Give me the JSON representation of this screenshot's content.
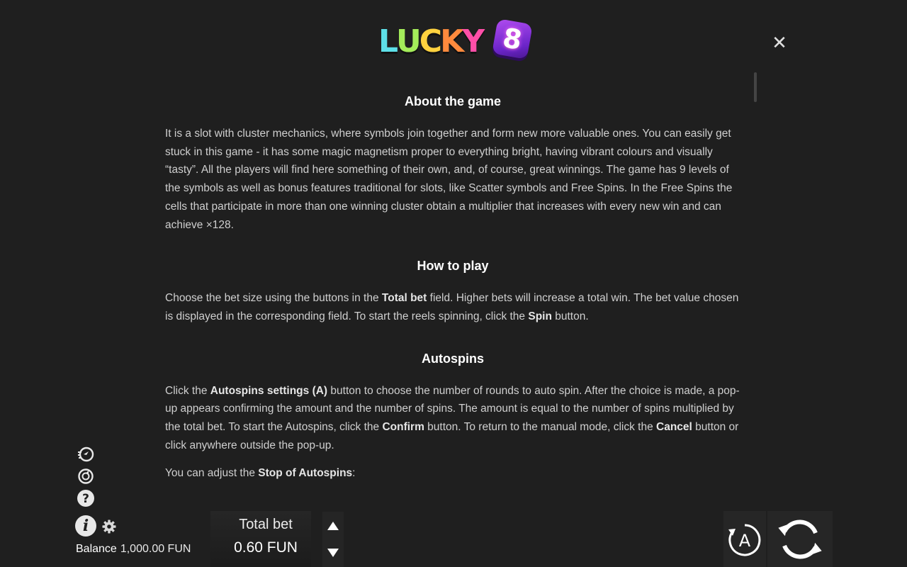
{
  "logo": {
    "letters": [
      "L",
      "U",
      "C",
      "K",
      "Y"
    ],
    "letter_colors": [
      "#5ee0e8",
      "#a4ec5a",
      "#ffd23f",
      "#ff8a3d",
      "#ff4fa8"
    ],
    "number": "8"
  },
  "close": {
    "icon": "close-icon",
    "glyph": "✕"
  },
  "rules": {
    "about": {
      "title": "About the game",
      "text": "It is a slot with cluster mechanics, where symbols join together and form new more valuable ones. You can easily get stuck in this game - it has some magic magnetism proper to everything bright, having vibrant colours and visually “tasty”. All the players will find here something of their own, and, of course, great winnings. The game has 9 levels of the symbols as well as bonus features traditional for slots, like Scatter symbols and Free Spins. In the Free Spins the cells that participate in more than one winning cluster obtain a multiplier that increases with every new win and can achieve ×128."
    },
    "how_to_play": {
      "title": "How to play",
      "t1": "Choose the bet size using the buttons in the ",
      "b1": "Total bet",
      "t2": " field. Higher bets will increase a total win. The bet value chosen is displayed in the corresponding field. To start the reels spinning, click the ",
      "b2": "Spin",
      "t3": " button."
    },
    "autospins": {
      "title": "Autospins",
      "t1": "Click the ",
      "b1": "Autospins settings (A)",
      "t2": " button to choose the number of rounds to auto spin. After the choice is made, a pop-up appears confirming the amount and the number of spins. The amount is equal to the number of spins multiplied by the total bet. To start the Autospins, click the ",
      "b2": "Confirm",
      "t3": " button. To return to the manual mode, click the ",
      "b3": "Cancel",
      "t4": " button or click anywhere outside the pop-up.",
      "stop_t1": "You can adjust the ",
      "stop_b1": "Stop of Autospins",
      "stop_t2": ":"
    }
  },
  "side_icons": [
    "turbo-icon",
    "history-icon",
    "help-icon"
  ],
  "help_glyph": "?",
  "info_glyph": "i",
  "balance": {
    "label": "Balance",
    "value": "1,000.00 FUN"
  },
  "bet": {
    "label": "Total bet",
    "value": "0.60 FUN"
  },
  "autospin": {
    "glyph": "A"
  },
  "colors": {
    "background": "#1f1f1f",
    "text": "#cfcfcf",
    "heading": "#ffffff"
  }
}
